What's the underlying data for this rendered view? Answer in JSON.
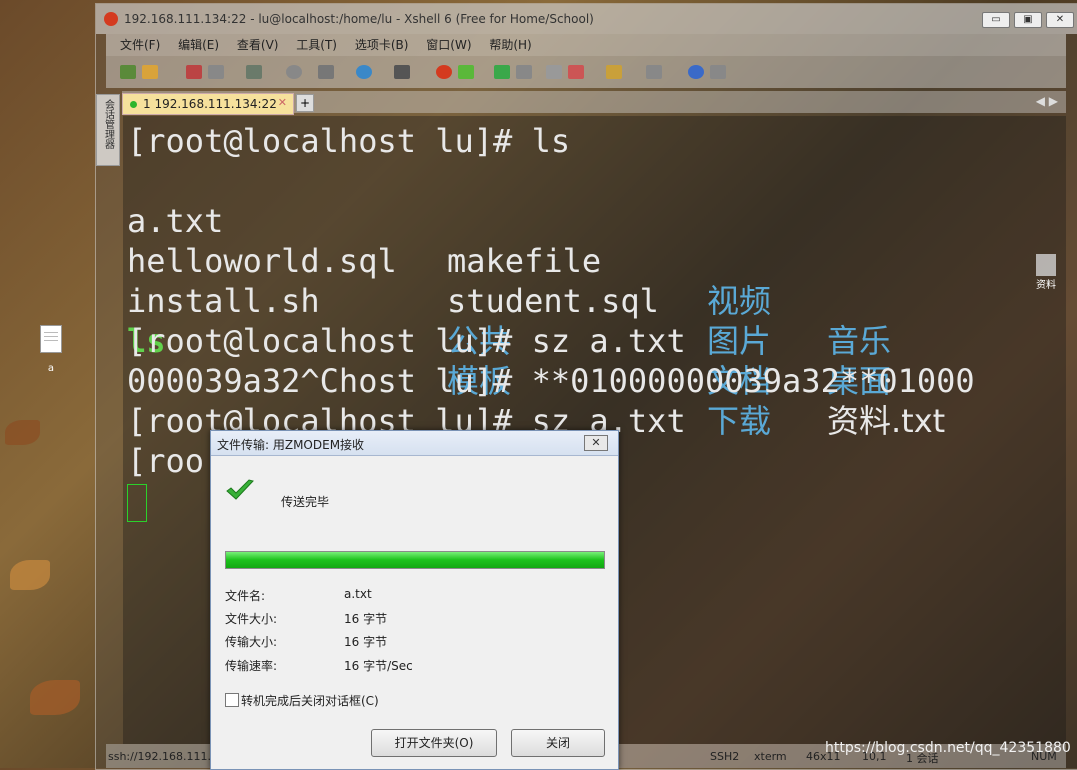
{
  "window": {
    "title": "192.168.111.134:22 - lu@localhost:/home/lu - Xshell 6 (Free for Home/School)",
    "min_btn": "▭",
    "max_btn": "▣",
    "close_btn": "✕"
  },
  "menu": [
    "文件(F)",
    "编辑(E)",
    "查看(V)",
    "工具(T)",
    "选项卡(B)",
    "窗口(W)",
    "帮助(H)"
  ],
  "sidetab_label": "会话管理器",
  "tab": {
    "label": "1 192.168.111.134:22",
    "close": "✕",
    "add": "+",
    "nav": "◀ ▶"
  },
  "terminal": {
    "lines": [
      {
        "text": "[root@localhost lu]# ls"
      },
      {
        "cells": [
          "a.txt",
          "makefile",
          "视频",
          "音乐"
        ]
      },
      {
        "cells": [
          "helloworld.sql",
          "student.sql",
          "图片",
          "桌面"
        ]
      },
      {
        "cells": [
          "install.sh",
          "公共",
          "文档",
          "资料.txt"
        ]
      },
      {
        "cells": [
          "ls",
          "模板",
          "下载"
        ]
      },
      {
        "text": "[root@localhost lu]# sz a.txt"
      },
      {
        "text": "000039a32^Chost lu]# **01000000039a32**01000"
      },
      {
        "text": "[root@localhost lu]# sz a.txt"
      },
      {
        "text": "[roo"
      }
    ]
  },
  "desktop_file": {
    "label": "a"
  },
  "overlay_file": {
    "label": "资料"
  },
  "statusbar": {
    "conn": "ssh://192.168.111.13",
    "proto": "SSH2",
    "term": "xterm",
    "size": "46x11",
    "pos": "10,1",
    "sessions": "1 会话",
    "num": "NUM"
  },
  "watermark": "https://blog.csdn.net/qq_42351880",
  "dialog": {
    "title": "文件传输: 用ZMODEM接收",
    "close": "✕",
    "status": "传送完毕",
    "progress": 1.0,
    "rows": [
      {
        "key": "文件名:",
        "value": "a.txt"
      },
      {
        "key": "文件大小:",
        "value": "16 字节"
      },
      {
        "key": "传输大小:",
        "value": "16 字节"
      },
      {
        "key": "传输速率:",
        "value": "16 字节/Sec"
      }
    ],
    "checkbox_label": "转机完成后关闭对话框(C)",
    "open_folder": "打开文件夹(O)",
    "close_btn": "关闭"
  }
}
